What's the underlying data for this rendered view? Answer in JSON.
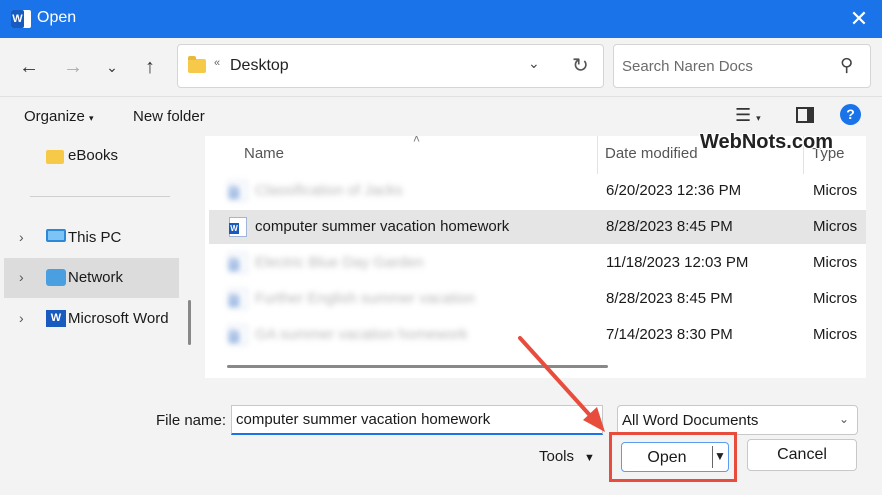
{
  "window": {
    "title": "Open"
  },
  "nav": {
    "address_path": "Desktop",
    "address_separator": "«",
    "search_placeholder": "Search Naren Docs"
  },
  "toolbar": {
    "organize": "Organize",
    "new_folder": "New folder",
    "help": "?"
  },
  "sidebar": {
    "items": [
      {
        "label": "eBooks",
        "icon": "folder-icon"
      },
      {
        "label": "This PC",
        "icon": "pc-icon"
      },
      {
        "label": "Network",
        "icon": "network-icon"
      },
      {
        "label": "Microsoft Word",
        "icon": "word-icon"
      }
    ]
  },
  "filelist": {
    "columns": {
      "name": "Name",
      "date": "Date modified",
      "type": "Type"
    },
    "rows": [
      {
        "name": "Classification of Jacks",
        "date": "6/20/2023 12:36 PM",
        "type": "Micros",
        "blurred": true
      },
      {
        "name": "computer summer vacation homework",
        "date": "8/28/2023 8:45 PM",
        "type": "Micros",
        "blurred": false
      },
      {
        "name": "Electric Blue Day Garden",
        "date": "11/18/2023 12:03 PM",
        "type": "Micros",
        "blurred": true
      },
      {
        "name": "Further English summer vacation",
        "date": "8/28/2023 8:45 PM",
        "type": "Micros",
        "blurred": true
      },
      {
        "name": "GA summer vacation homework",
        "date": "7/14/2023 8:30 PM",
        "type": "Micros",
        "blurred": true
      }
    ]
  },
  "watermark": "WebNots.com",
  "bottom": {
    "file_name_label": "File name:",
    "file_name_value": "computer summer vacation homework",
    "filter": "All Word Documents",
    "tools": "Tools",
    "open": "Open",
    "cancel": "Cancel"
  },
  "colors": {
    "accent": "#1a73e8",
    "highlight": "#e84c3d"
  }
}
